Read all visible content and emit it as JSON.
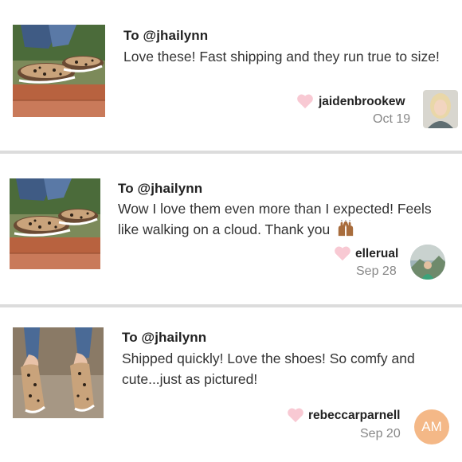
{
  "reviews": [
    {
      "to": "To @jhailynn",
      "message": "Love these! Fast shipping and they run true to size!",
      "username": "jaidenbrookew",
      "date": "Oct 19",
      "avatar_icon": "user-photo"
    },
    {
      "to": "To @jhailynn",
      "message": "Wow I love them even more than I expected! Feels like walking on a cloud. Thank you",
      "emoji": "raising-hands-emoji",
      "username": "ellerual",
      "date": "Sep 28",
      "avatar_icon": "user-photo"
    },
    {
      "to": "To @jhailynn",
      "message": "Shipped quickly! Love the shoes! So comfy and cute...just as pictured!",
      "username": "rebeccarparnell",
      "date": "Sep 20",
      "avatar_initials": "AM"
    }
  ],
  "colors": {
    "heart": "#f8c9d3",
    "avatar_initials_bg": "#f4b887",
    "date_text": "#888888"
  }
}
